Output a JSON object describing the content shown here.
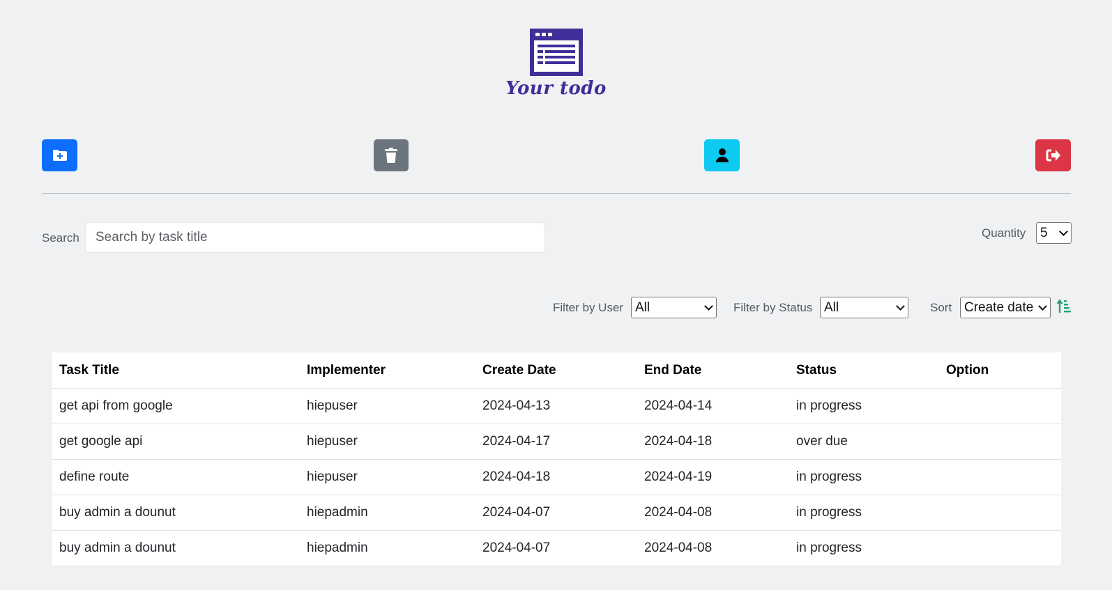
{
  "app": {
    "logo_text": "Your todo",
    "brand_color": "#3f2f98"
  },
  "toolbar": {
    "add_icon": "folder-plus-icon",
    "trash_icon": "trash-icon",
    "user_icon": "user-icon",
    "logout_icon": "logout-icon",
    "colors": {
      "add": "#0d6efd",
      "trash": "#6c757d",
      "user": "#0dcaf0",
      "logout": "#dc3545"
    }
  },
  "search": {
    "label": "Search",
    "placeholder": "Search by task title",
    "value": ""
  },
  "quantity": {
    "label": "Quantity",
    "value": "5"
  },
  "filters": {
    "user_label": "Filter by User",
    "user_value": "All",
    "status_label": "Filter by Status",
    "status_value": "All",
    "sort_label": "Sort",
    "sort_value": "Create date",
    "sort_icon": "sort-ascending-icon"
  },
  "table": {
    "columns": [
      "Task Title",
      "Implementer",
      "Create Date",
      "End Date",
      "Status",
      "Option"
    ],
    "rows": [
      [
        "get api from google",
        "hiepuser",
        "2024-04-13",
        "2024-04-14",
        "in progress",
        ""
      ],
      [
        "get google api",
        "hiepuser",
        "2024-04-17",
        "2024-04-18",
        "over due",
        ""
      ],
      [
        "define route",
        "hiepuser",
        "2024-04-18",
        "2024-04-19",
        "in progress",
        ""
      ],
      [
        "buy admin a dounut",
        "hiepadmin",
        "2024-04-07",
        "2024-04-08",
        "in progress",
        ""
      ],
      [
        "buy admin a dounut",
        "hiepadmin",
        "2024-04-07",
        "2024-04-08",
        "in progress",
        ""
      ]
    ]
  }
}
